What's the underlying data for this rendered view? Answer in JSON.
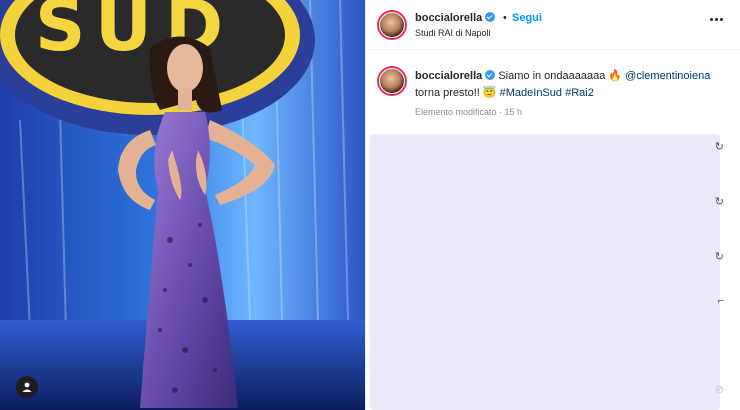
{
  "post": {
    "username": "boccialorella",
    "follow_label": "Segui",
    "separator": "•",
    "location": "Studi RAI di Napoli",
    "caption": {
      "text_main": "Siamo in ondaaaaaaa 🔥 ",
      "mention": "@clementinoiena",
      "text_after": " torna presto!! 😇 ",
      "hashtag_1": "#MadeInSud",
      "hashtag_2": "#Rai2"
    },
    "edited_label": "Elemento modificato",
    "time_sep": " · ",
    "time_ago": "15 h"
  },
  "edge_glyphs": [
    "↻",
    "↻",
    "↻",
    "⌐",
    "⊘"
  ],
  "icons": {
    "verified": "verified-badge-icon",
    "more": "more-options-icon",
    "user_tag": "user-tag-icon"
  },
  "colors": {
    "follow": "#0095f6",
    "verified": "#3897f0",
    "link": "#00376b",
    "panel": "#ede9f8"
  }
}
